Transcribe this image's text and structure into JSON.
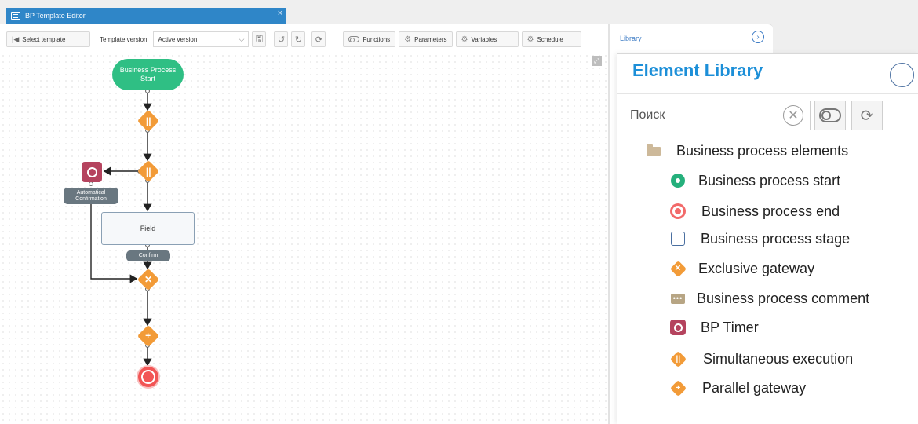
{
  "window": {
    "tab_title": "BP Template Editor",
    "close": "×"
  },
  "toolbar": {
    "select_template": "Select template",
    "template_version_label": "Template version",
    "version_value": "Active version",
    "functions": "Functions",
    "parameters": "Parameters",
    "variables": "Variables",
    "schedule": "Schedule"
  },
  "side_panel": {
    "header": "Library"
  },
  "library": {
    "title": "Element Library",
    "search_placeholder": "Поиск",
    "root": "Business process elements",
    "items": [
      {
        "label": "Business process start",
        "icon": "bp-start-icon"
      },
      {
        "label": "Business process end",
        "icon": "bp-end-icon"
      },
      {
        "label": "Business process stage",
        "icon": "bp-stage-icon"
      },
      {
        "label": "Exclusive gateway",
        "icon": "exclusive-gateway-icon"
      },
      {
        "label": "Business process comment",
        "icon": "comment-icon"
      },
      {
        "label": "BP Timer",
        "icon": "timer-icon"
      },
      {
        "label": "Simultaneous execution",
        "icon": "simultaneous-icon"
      },
      {
        "label": "Parallel gateway",
        "icon": "parallel-gateway-icon"
      }
    ]
  },
  "diagram": {
    "start": "Business Process Start",
    "timer_label": "Automatical Confirmation",
    "field": "Field",
    "confirm": "Confirm"
  },
  "colors": {
    "accent": "#1c8fd8",
    "start_green": "#2fbf84",
    "gateway_orange": "#f29b38",
    "timer_purple": "#b5435e",
    "end_red": "#f25555"
  }
}
